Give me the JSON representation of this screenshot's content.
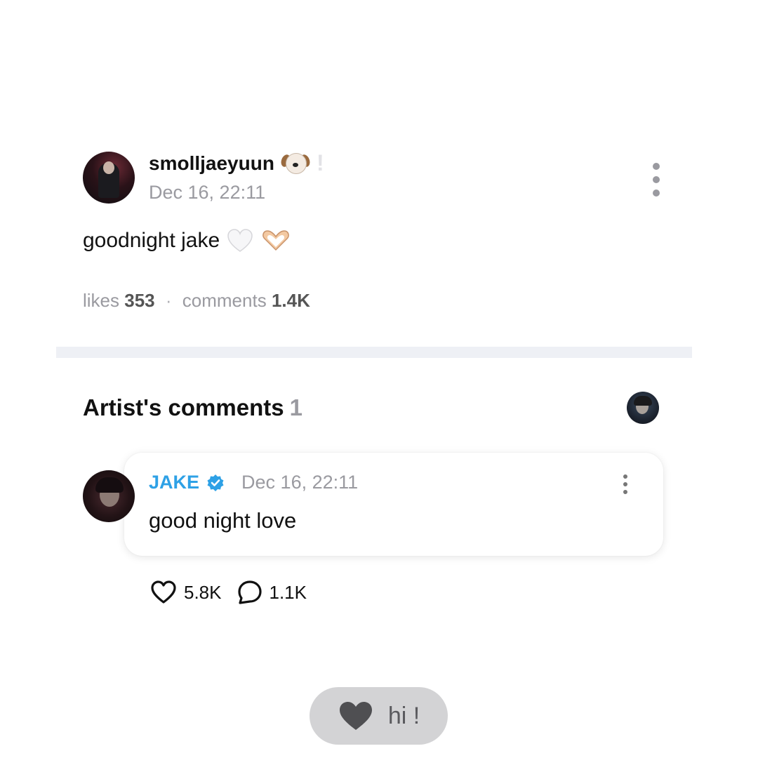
{
  "post": {
    "username": "smolljaeyuun",
    "username_emoji": "dog-face-icon",
    "username_extra": "!",
    "date": "Dec 16, 22:11",
    "body": "goodnight jake",
    "body_emojis": [
      "white-heart-icon",
      "heart-hands-icon"
    ],
    "likes_label": "likes",
    "likes": "353",
    "separator": "·",
    "comments_label": "comments",
    "comments": "1.4K"
  },
  "artist_comments": {
    "title": "Artist's comments",
    "count": "1",
    "comment": {
      "author": "JAKE",
      "verified": true,
      "date": "Dec 16, 22:11",
      "text": "good night love",
      "likes": "5.8K",
      "replies": "1.1K"
    }
  },
  "footer_pill": {
    "icon": "heart-icon",
    "label": "hi !"
  },
  "colors": {
    "artist_name": "#2ea1e6",
    "muted": "#9a9aa0",
    "divider": "#eef0f5",
    "pill_bg": "#d3d3d5"
  }
}
